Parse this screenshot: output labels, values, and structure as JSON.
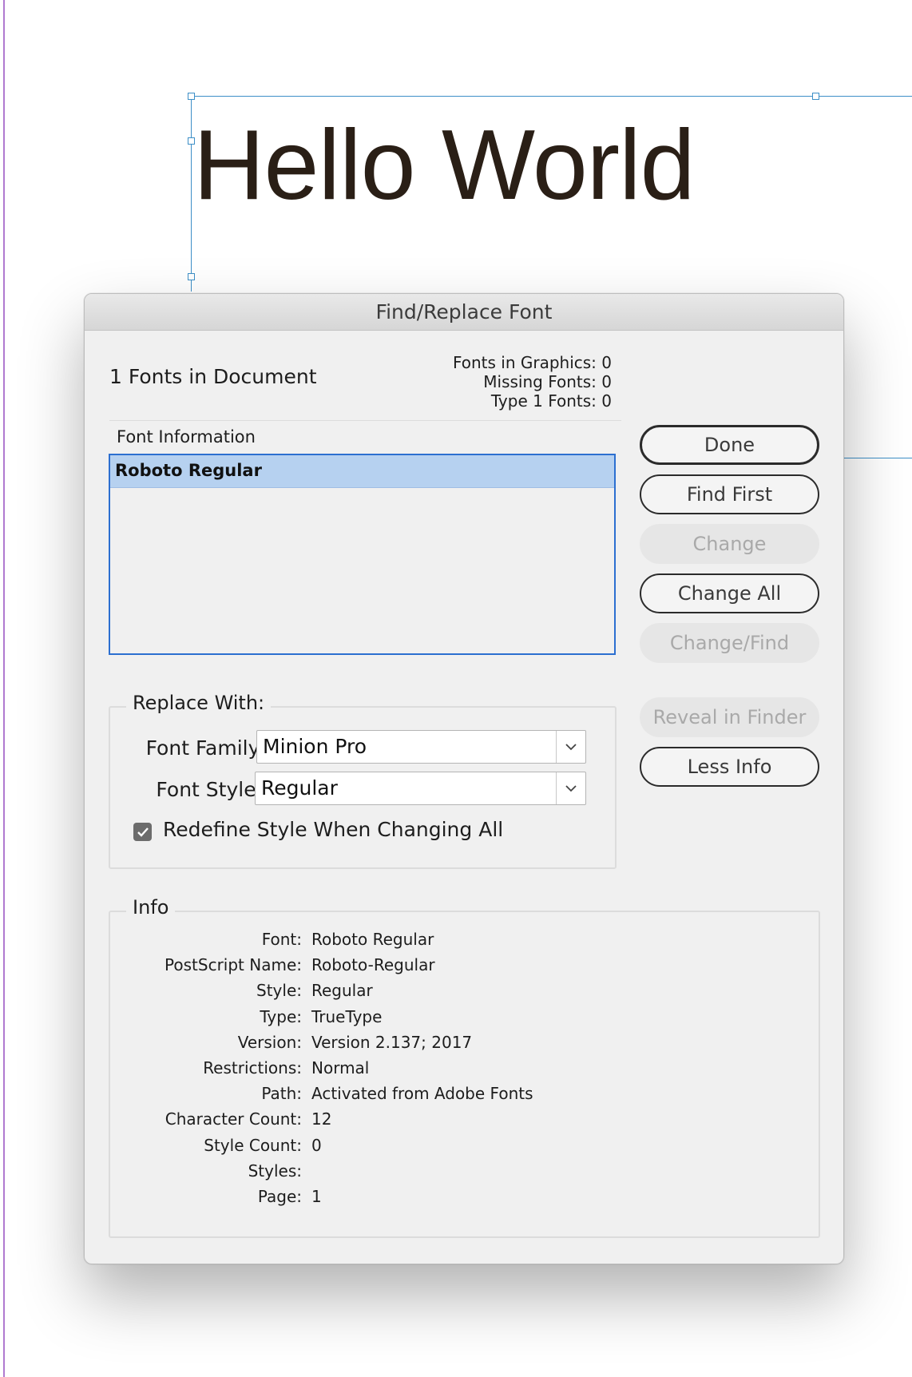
{
  "document": {
    "text": "Hello World"
  },
  "dialog": {
    "title": "Find/Replace Font",
    "fonts_in_document": "1 Fonts in Document",
    "stats": {
      "fonts_in_graphics": "Fonts in Graphics: 0",
      "missing_fonts": "Missing Fonts: 0",
      "type1_fonts": "Type 1 Fonts: 0"
    },
    "font_information_label": "Font Information",
    "font_list": [
      {
        "name": "Roboto Regular",
        "selected": true
      }
    ],
    "buttons": {
      "done": "Done",
      "find_first": "Find First",
      "change": "Change",
      "change_all": "Change All",
      "change_find": "Change/Find",
      "reveal_in_finder": "Reveal in Finder",
      "less_info": "Less Info"
    },
    "replace_with": {
      "legend": "Replace With:",
      "font_family_label": "Font Family:",
      "font_family_value": "Minion Pro",
      "font_style_label": "Font Style:",
      "font_style_value": "Regular",
      "redefine_label": "Redefine Style When Changing All",
      "redefine_checked": true
    },
    "info": {
      "legend": "Info",
      "rows": [
        {
          "key": "Font:",
          "value": "Roboto Regular"
        },
        {
          "key": "PostScript Name:",
          "value": "Roboto-Regular"
        },
        {
          "key": "Style:",
          "value": "Regular"
        },
        {
          "key": "Type:",
          "value": "TrueType"
        },
        {
          "key": "Version:",
          "value": "Version 2.137; 2017"
        },
        {
          "key": "Restrictions:",
          "value": "Normal"
        },
        {
          "key": "Path:",
          "value": "Activated from Adobe Fonts"
        },
        {
          "key": "Character Count:",
          "value": "12"
        },
        {
          "key": "Style Count:",
          "value": "0"
        },
        {
          "key": "Styles:",
          "value": ""
        },
        {
          "key": "Page:",
          "value": "1"
        }
      ]
    }
  }
}
